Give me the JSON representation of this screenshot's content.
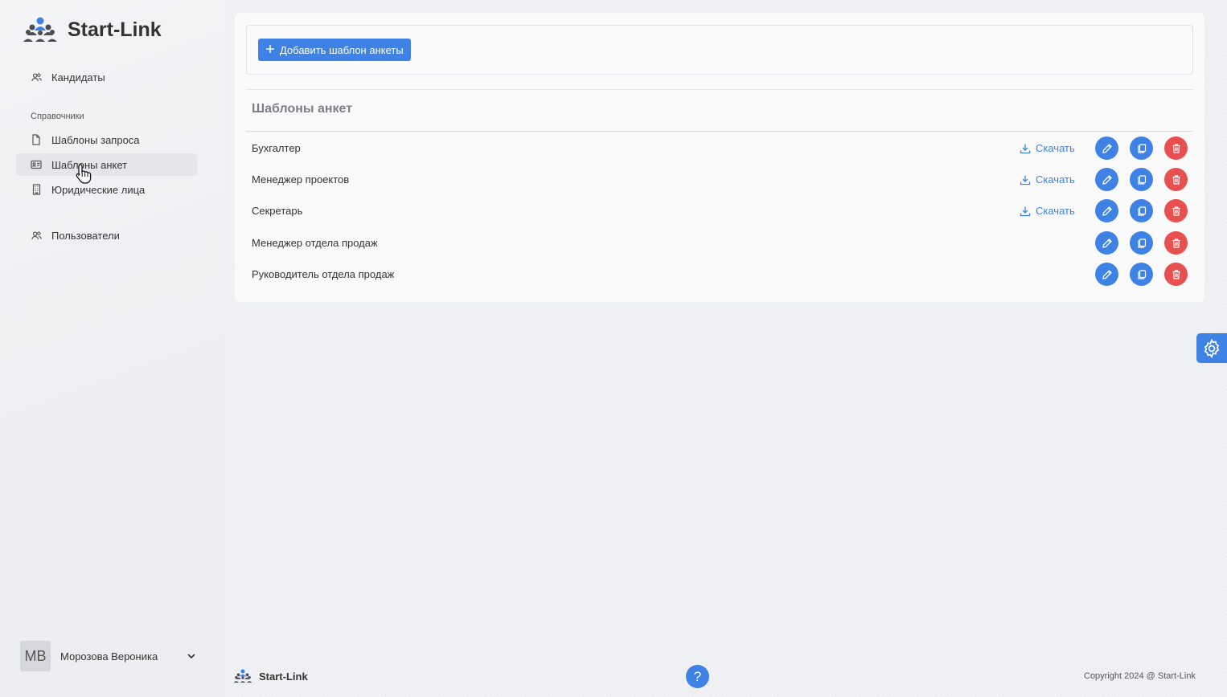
{
  "app": {
    "title": "Start-Link"
  },
  "sidebar": {
    "candidates": "Кандидаты",
    "section_label": "Справочники",
    "items": [
      {
        "label": "Шаблоны запроса"
      },
      {
        "label": "Шаблоны анкет"
      },
      {
        "label": "Юридические лица"
      }
    ],
    "users": "Пользователи",
    "active": "Шаблоны анкет"
  },
  "user": {
    "initials": "МВ",
    "name": "Морозова Вероника"
  },
  "main": {
    "add_button": "Добавить шаблон анкеты",
    "section_title": "Шаблоны анкет",
    "download_label": "Скачать",
    "rows": [
      {
        "name": "Бухгалтер",
        "download": "Скачать"
      },
      {
        "name": "Менеджер проектов",
        "download": "Скачать"
      },
      {
        "name": "Секретарь",
        "download": "Скачать"
      },
      {
        "name": "Менеджер отдела продаж",
        "download": ""
      },
      {
        "name": "Руководитель отдела продаж",
        "download": ""
      }
    ]
  },
  "footer": {
    "logo": "Start-Link",
    "help": "?",
    "copyright": "Copyright 2024 @ Start-Link"
  },
  "colors": {
    "accent": "#3e82e6",
    "danger": "#e8504f"
  }
}
